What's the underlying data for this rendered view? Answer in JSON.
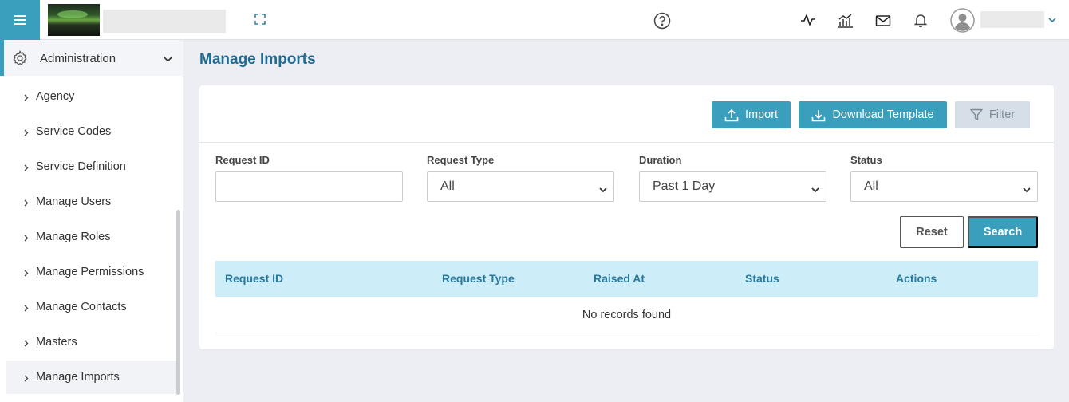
{
  "header": {
    "icons": [
      "menu-icon",
      "fullscreen-icon",
      "help-icon",
      "activity-icon",
      "analytics-icon",
      "mail-icon",
      "bell-icon",
      "user-avatar-icon",
      "chevron-down-icon"
    ]
  },
  "sidebar": {
    "section": "Administration",
    "items": [
      {
        "label": "Agency"
      },
      {
        "label": "Service Codes"
      },
      {
        "label": "Service Definition"
      },
      {
        "label": "Manage Users"
      },
      {
        "label": "Manage Roles"
      },
      {
        "label": "Manage Permissions"
      },
      {
        "label": "Manage Contacts"
      },
      {
        "label": "Masters"
      },
      {
        "label": "Manage Imports"
      }
    ],
    "active": "Manage Imports"
  },
  "main": {
    "title": "Manage Imports",
    "toolbar": {
      "import_label": "Import",
      "download_label": "Download Template",
      "filter_label": "Filter"
    },
    "filters": {
      "request_id_label": "Request ID",
      "request_id_value": "",
      "request_type_label": "Request Type",
      "request_type_value": "All",
      "duration_label": "Duration",
      "duration_value": "Past 1 Day",
      "status_label": "Status",
      "status_value": "All"
    },
    "reset_label": "Reset",
    "search_label": "Search",
    "table": {
      "columns": [
        "Request ID",
        "Request Type",
        "Raised At",
        "Status",
        "Actions"
      ],
      "empty_message": "No records found"
    }
  },
  "colors": {
    "accent": "#3a9fbd",
    "title": "#1d6b92",
    "table_header_bg": "#cdeef8",
    "table_header_text": "#2a7a9e"
  }
}
